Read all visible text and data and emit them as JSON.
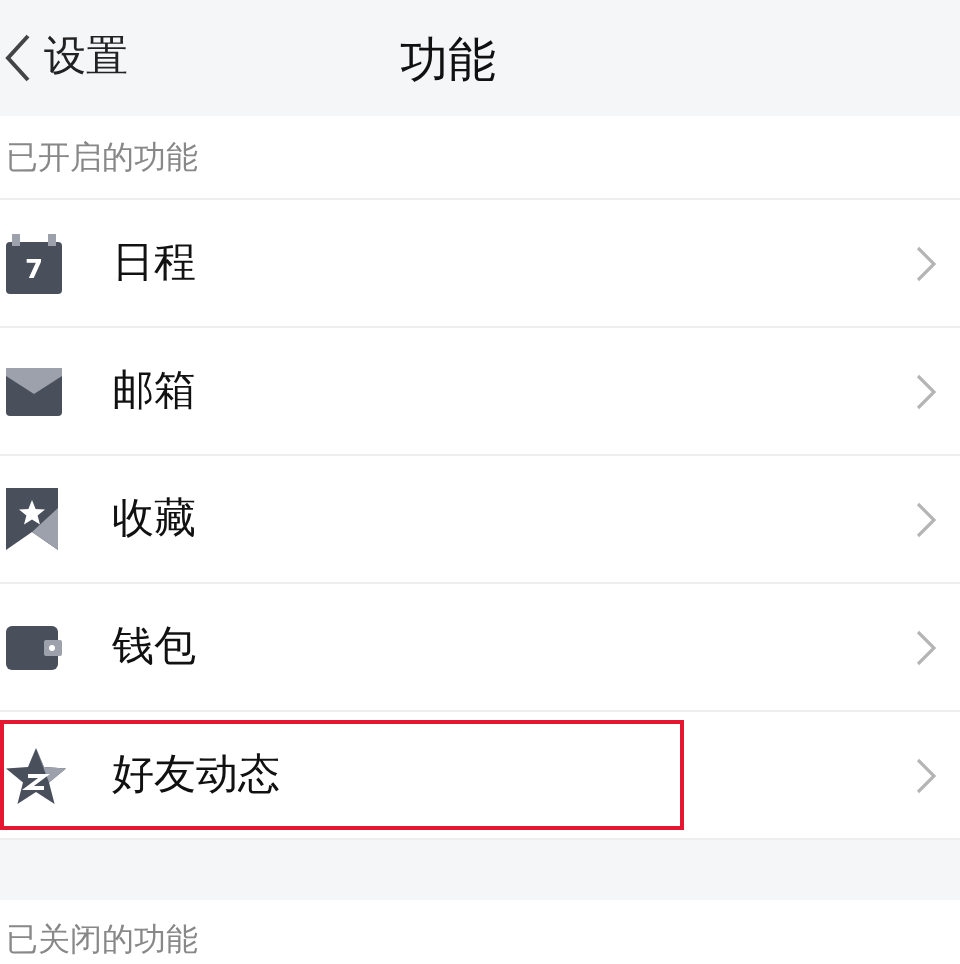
{
  "nav": {
    "back_label": "设置",
    "title": "功能"
  },
  "enabled_section": {
    "label": "已开启的功能",
    "items": [
      {
        "kind": "calendar",
        "icon_text": "7",
        "label": "日程",
        "highlighted": false
      },
      {
        "kind": "mail",
        "label": "邮箱",
        "highlighted": false
      },
      {
        "kind": "bookmark",
        "label": "收藏",
        "highlighted": false
      },
      {
        "kind": "wallet",
        "label": "钱包",
        "highlighted": false
      },
      {
        "kind": "star",
        "label": "好友动态",
        "highlighted": true
      }
    ]
  },
  "disabled_section": {
    "label": "已关闭的功能"
  }
}
